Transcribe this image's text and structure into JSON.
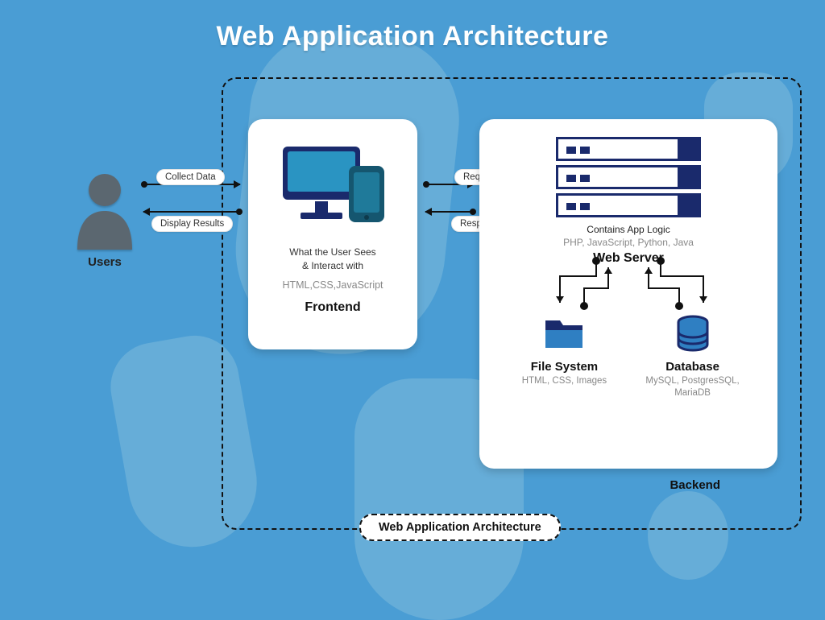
{
  "title": "Web Application Architecture",
  "users": {
    "label": "Users"
  },
  "arrows": {
    "user_to_frontend": {
      "top": "Collect Data",
      "bottom": "Display Results"
    },
    "frontend_to_backend": {
      "top": "Request",
      "bottom": "Response"
    }
  },
  "frontend": {
    "desc1": "What the User Sees",
    "desc2": "& Interact with",
    "tech": "HTML,CSS,JavaScript",
    "name": "Frontend"
  },
  "backend": {
    "desc": "Contains App Logic",
    "tech": "PHP, JavaScript, Python, Java",
    "webserver": "Web Server",
    "filesystem": {
      "title": "File System",
      "tech": "HTML, CSS, Images"
    },
    "database": {
      "title": "Database",
      "tech": "MySQL, PostgresSQL, MariaDB"
    },
    "label": "Backend"
  },
  "footer": "Web Application Architecture"
}
